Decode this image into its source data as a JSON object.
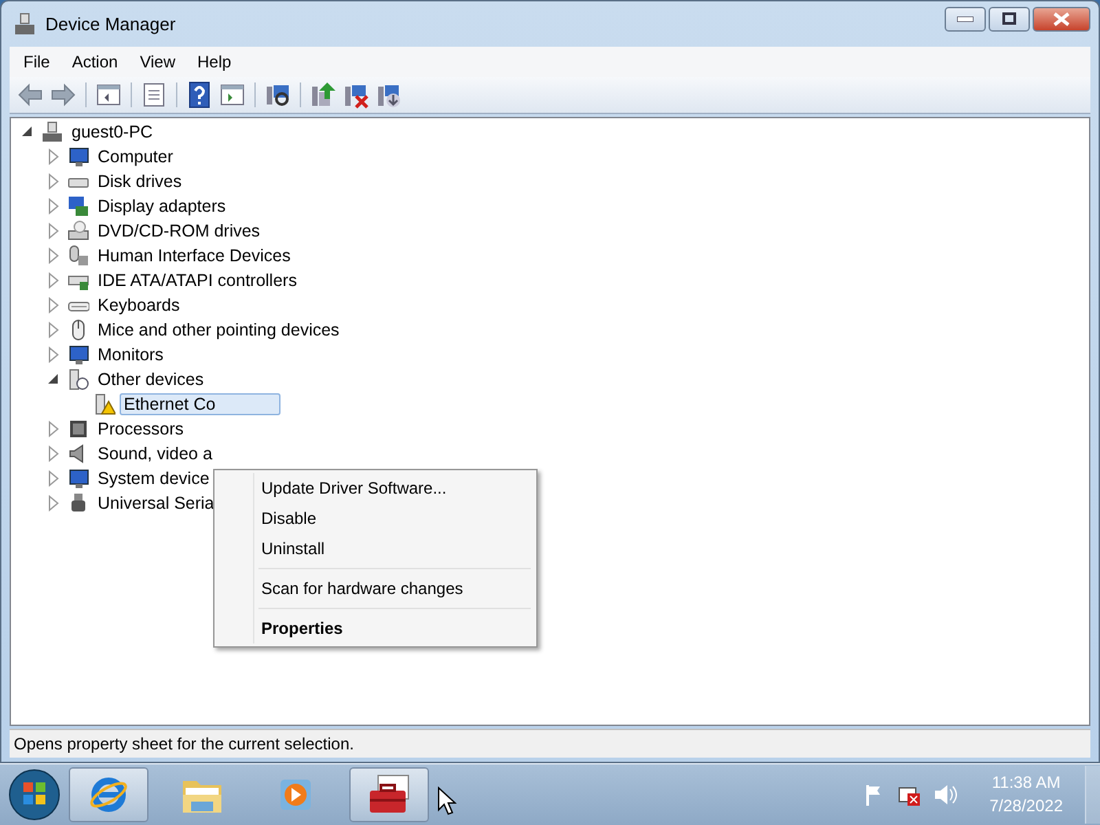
{
  "window": {
    "title": "Device Manager"
  },
  "menu": [
    "File",
    "Action",
    "View",
    "Help"
  ],
  "tree": {
    "label": "guest0-PC",
    "expanded": true,
    "children": [
      {
        "label": "Computer",
        "expanded": false
      },
      {
        "label": "Disk drives",
        "expanded": false
      },
      {
        "label": "Display adapters",
        "expanded": false
      },
      {
        "label": "DVD/CD-ROM drives",
        "expanded": false
      },
      {
        "label": "Human Interface Devices",
        "expanded": false
      },
      {
        "label": "IDE ATA/ATAPI controllers",
        "expanded": false
      },
      {
        "label": "Keyboards",
        "expanded": false
      },
      {
        "label": "Mice and other pointing devices",
        "expanded": false
      },
      {
        "label": "Monitors",
        "expanded": false
      },
      {
        "label": "Other devices",
        "expanded": true,
        "children": [
          {
            "label": "Ethernet Co",
            "selected": true
          }
        ]
      },
      {
        "label": "Processors",
        "expanded": false
      },
      {
        "label": "Sound, video a",
        "expanded": false
      },
      {
        "label": "System device",
        "expanded": false
      },
      {
        "label": "Universal Seria",
        "expanded": false
      }
    ]
  },
  "context_menu": [
    {
      "kind": "item",
      "label": "Update Driver Software...",
      "default": false
    },
    {
      "kind": "item",
      "label": "Disable",
      "default": false
    },
    {
      "kind": "item",
      "label": "Uninstall",
      "default": false
    },
    {
      "kind": "separator"
    },
    {
      "kind": "item",
      "label": "Scan for hardware changes",
      "default": false
    },
    {
      "kind": "separator"
    },
    {
      "kind": "item",
      "label": "Properties",
      "default": true
    }
  ],
  "status_bar": "Opens property sheet for the current selection.",
  "clock": {
    "time": "11:38 AM",
    "date": "7/28/2022"
  }
}
